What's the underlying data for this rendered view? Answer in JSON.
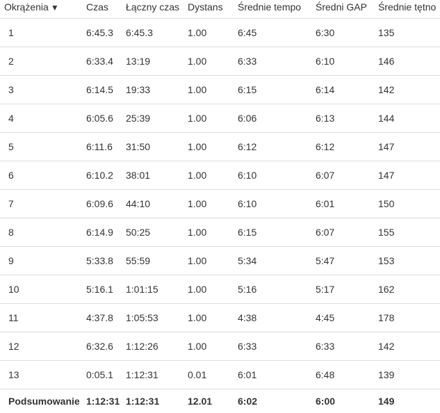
{
  "headers": {
    "lap": "Okrążenia",
    "lap_sort_icon": "▼",
    "time": "Czas",
    "total_time": "Łączny czas",
    "distance": "Dystans",
    "avg_pace": "Średnie tempo",
    "avg_gap": "Średni GAP",
    "avg_hr": "Średnie tętno"
  },
  "rows": [
    {
      "lap": "1",
      "time": "6:45.3",
      "total": "6:45.3",
      "dist": "1.00",
      "pace": "6:45",
      "gap": "6:30",
      "hr": "135"
    },
    {
      "lap": "2",
      "time": "6:33.4",
      "total": "13:19",
      "dist": "1.00",
      "pace": "6:33",
      "gap": "6:10",
      "hr": "146"
    },
    {
      "lap": "3",
      "time": "6:14.5",
      "total": "19:33",
      "dist": "1.00",
      "pace": "6:15",
      "gap": "6:14",
      "hr": "142"
    },
    {
      "lap": "4",
      "time": "6:05.6",
      "total": "25:39",
      "dist": "1.00",
      "pace": "6:06",
      "gap": "6:13",
      "hr": "144"
    },
    {
      "lap": "5",
      "time": "6:11.6",
      "total": "31:50",
      "dist": "1.00",
      "pace": "6:12",
      "gap": "6:12",
      "hr": "147"
    },
    {
      "lap": "6",
      "time": "6:10.2",
      "total": "38:01",
      "dist": "1.00",
      "pace": "6:10",
      "gap": "6:07",
      "hr": "147"
    },
    {
      "lap": "7",
      "time": "6:09.6",
      "total": "44:10",
      "dist": "1.00",
      "pace": "6:10",
      "gap": "6:01",
      "hr": "150"
    },
    {
      "lap": "8",
      "time": "6:14.9",
      "total": "50:25",
      "dist": "1.00",
      "pace": "6:15",
      "gap": "6:07",
      "hr": "155"
    },
    {
      "lap": "9",
      "time": "5:33.8",
      "total": "55:59",
      "dist": "1.00",
      "pace": "5:34",
      "gap": "5:47",
      "hr": "153"
    },
    {
      "lap": "10",
      "time": "5:16.1",
      "total": "1:01:15",
      "dist": "1.00",
      "pace": "5:16",
      "gap": "5:17",
      "hr": "162"
    },
    {
      "lap": "11",
      "time": "4:37.8",
      "total": "1:05:53",
      "dist": "1.00",
      "pace": "4:38",
      "gap": "4:45",
      "hr": "178"
    },
    {
      "lap": "12",
      "time": "6:32.6",
      "total": "1:12:26",
      "dist": "1.00",
      "pace": "6:33",
      "gap": "6:33",
      "hr": "142"
    },
    {
      "lap": "13",
      "time": "0:05.1",
      "total": "1:12:31",
      "dist": "0.01",
      "pace": "6:01",
      "gap": "6:48",
      "hr": "139"
    }
  ],
  "summary": {
    "label": "Podsumowanie",
    "time": "1:12:31",
    "total": "1:12:31",
    "dist": "12.01",
    "pace": "6:02",
    "gap": "6:00",
    "hr": "149"
  },
  "colors": {
    "text": "#333333",
    "divider": "#dcdcdc",
    "background": "#ffffff"
  }
}
